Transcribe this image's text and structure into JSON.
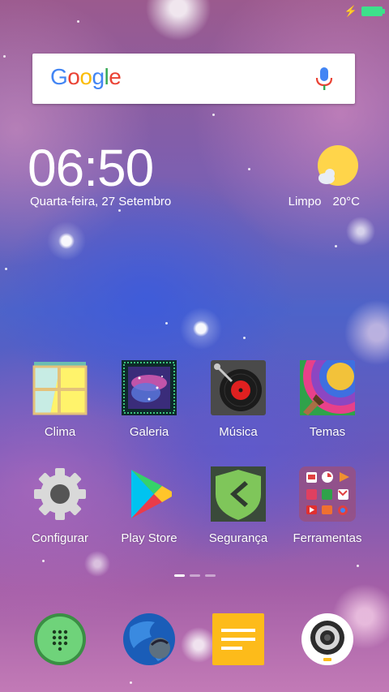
{
  "status_bar": {
    "charging_icon": "bolt-icon",
    "battery_icon": "battery-full-icon",
    "battery_color": "#3de08b"
  },
  "search": {
    "logo_letters": [
      "G",
      "o",
      "o",
      "g",
      "l",
      "e"
    ],
    "logo_colors": [
      "#4285F4",
      "#EA4335",
      "#FBBC05",
      "#4285F4",
      "#34A853",
      "#EA4335"
    ],
    "mic_icon": "microphone-icon"
  },
  "clock_widget": {
    "time": "06:50",
    "date": "Quarta-feira, 27 Setembro",
    "weather_icon": "partly-sunny-icon",
    "condition": "Limpo",
    "temperature": "20°C"
  },
  "apps": [
    {
      "label": "Clima",
      "icon": "weather-window-icon"
    },
    {
      "label": "Galeria",
      "icon": "gallery-icon"
    },
    {
      "label": "Música",
      "icon": "music-record-icon"
    },
    {
      "label": "Temas",
      "icon": "themes-palette-icon"
    },
    {
      "label": "Configurar",
      "icon": "settings-gear-icon"
    },
    {
      "label": "Play Store",
      "icon": "play-store-icon"
    },
    {
      "label": "Segurança",
      "icon": "security-shield-icon"
    },
    {
      "label": "Ferramentas",
      "icon": "tools-folder-icon"
    }
  ],
  "page_indicator": {
    "pages": 3,
    "active": 1
  },
  "dock": [
    {
      "icon": "phone-dialer-icon"
    },
    {
      "icon": "browser-globe-icon"
    },
    {
      "icon": "notes-icon"
    },
    {
      "icon": "camera-icon"
    }
  ]
}
